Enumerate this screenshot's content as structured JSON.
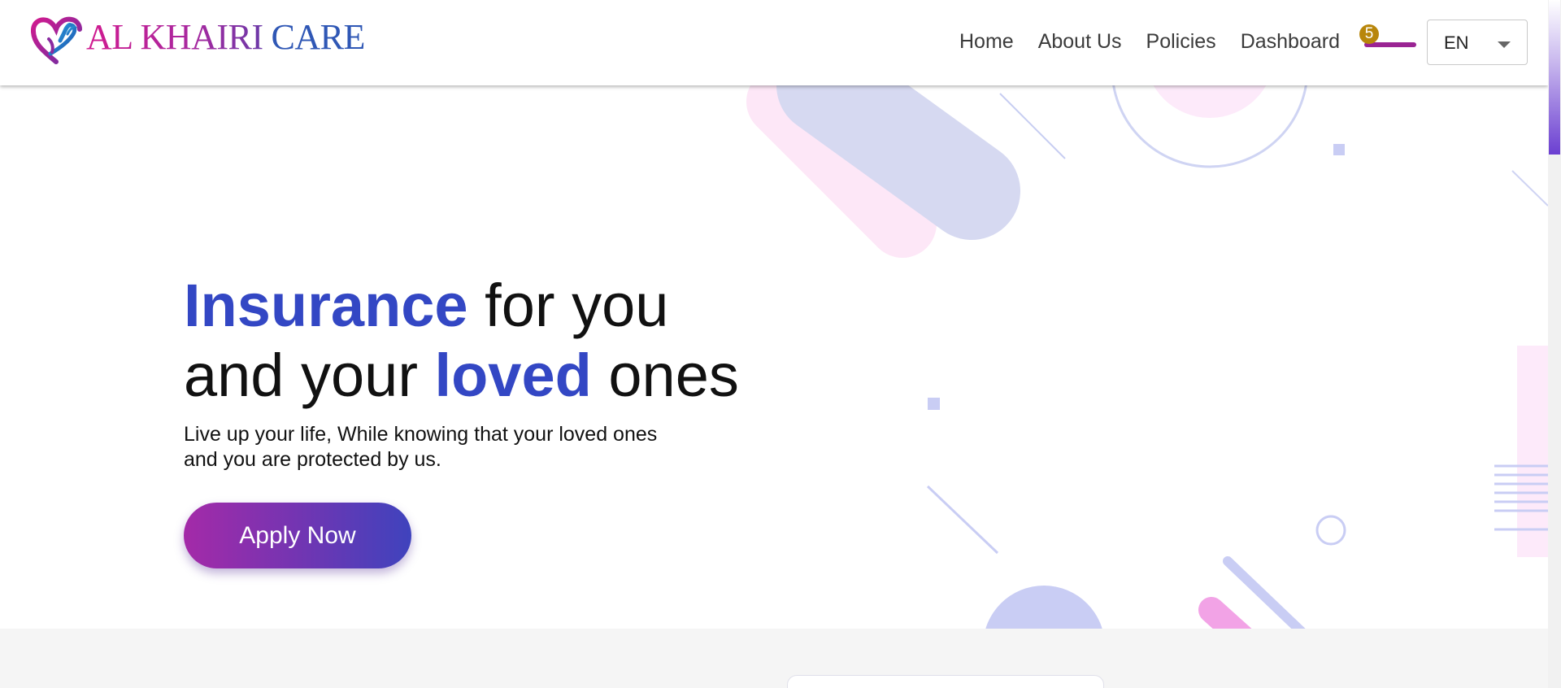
{
  "brand": {
    "name_part1": "AL KHAIRI",
    "name_part2": "CARE",
    "logo_icon": "heart-hands-icon"
  },
  "nav": {
    "items": [
      "Home",
      "About Us",
      "Policies",
      "Dashboard"
    ]
  },
  "cart": {
    "count": "5",
    "icon": "cart-icon"
  },
  "language": {
    "selected": "EN",
    "icon": "chevron-down-icon"
  },
  "hero": {
    "title_accent_1": "Insurance",
    "title_mid_1": " for you",
    "title_mid_2": "and your ",
    "title_accent_2": "loved",
    "title_end": " ones",
    "subtitle": "Live up your life, While knowing that your loved ones and you are protected by us.",
    "cta_label": "Apply Now"
  },
  "colors": {
    "accent_blue": "#3347c4",
    "brand_magenta": "#d11a8f",
    "brand_blue": "#2f57b5",
    "cta_gradient_start": "#a42aa8",
    "cta_gradient_end": "#3f43bd",
    "badge": "#b8860b"
  }
}
